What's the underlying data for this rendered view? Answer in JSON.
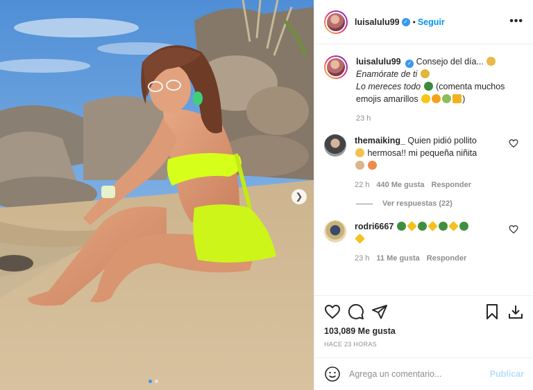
{
  "post": {
    "username": "luisalulu99",
    "follow_label": "Seguir",
    "separator": "•",
    "more_label": "•••"
  },
  "caption": {
    "username": "luisalulu99",
    "line1": "Consejo del día...",
    "line2": "Enamórate de ti",
    "line3_italic": "Lo mereces todo",
    "line3_rest": "(comenta muchos emojis amarillos",
    "line3_end": ")",
    "time": "23 h"
  },
  "comments": [
    {
      "username": "themaiking_",
      "text_a": "Quien pidió pollito",
      "text_b": "hermosa!! mi pequeña niñita",
      "time": "22 h",
      "likes": "440 Me gusta",
      "reply_label": "Responder",
      "view_replies": "Ver respuestas (22)"
    },
    {
      "username": "rodri6667",
      "time": "23 h",
      "likes": "11 Me gusta",
      "reply_label": "Responder"
    }
  ],
  "stats": {
    "likes": "103,089 Me gusta",
    "time_ago": "HACE 23 HORAS"
  },
  "composer": {
    "placeholder": "Agrega un comentario...",
    "publish_label": "Publicar"
  },
  "carousel": {
    "next_icon": "chevron-right-icon",
    "count": 2,
    "active_index": 0
  },
  "colors": {
    "accent": "#0095f6",
    "verified": "#3897f0",
    "publish_disabled": "#b2dffc",
    "muted": "#8e8e8e",
    "bikini": "#d6ff1a"
  }
}
